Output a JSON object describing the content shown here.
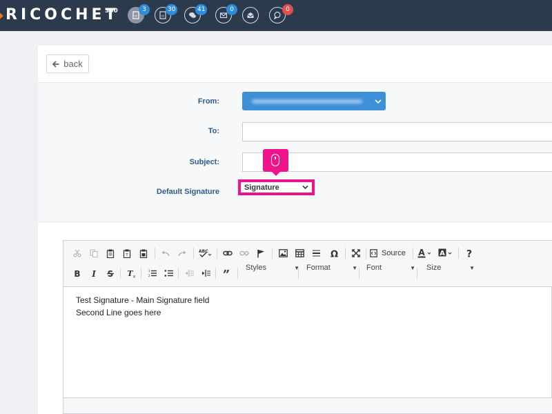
{
  "brand": {
    "name": "RICOCHET",
    "sup": "360"
  },
  "nav": {
    "items": [
      {
        "name": "campaigns-icon",
        "count": "3",
        "badge_color": "#2f8ad8"
      },
      {
        "name": "templates-icon",
        "count": "30",
        "badge_color": "#2f8ad8"
      },
      {
        "name": "chat-icon",
        "count": "41",
        "badge_color": "#2f8ad8"
      },
      {
        "name": "mail-icon",
        "count": "0",
        "badge_color": "#2f8ad8"
      },
      {
        "name": "inbox-icon",
        "count": "",
        "badge_color": ""
      },
      {
        "name": "comment-icon",
        "count": "0",
        "badge_color": "#e05050"
      }
    ]
  },
  "back": {
    "label": "back"
  },
  "form": {
    "from_label": "From:",
    "to_label": "To:",
    "subject_label": "Subject:",
    "signature_label": "Default Signature",
    "signature_value": "Signature"
  },
  "toolbar": {
    "source_label": "Source",
    "styles_label": "Styles",
    "format_label": "Format",
    "font_label": "Font",
    "size_label": "Size"
  },
  "content": {
    "line1": "Test Signature - Main Signature field",
    "line2": "Second Line goes here"
  },
  "colors": {
    "topbar": "#2b3a4d",
    "highlight": "#f0148c",
    "from_select": "#3d8fd7",
    "label_blue": "#2c5a8a"
  }
}
